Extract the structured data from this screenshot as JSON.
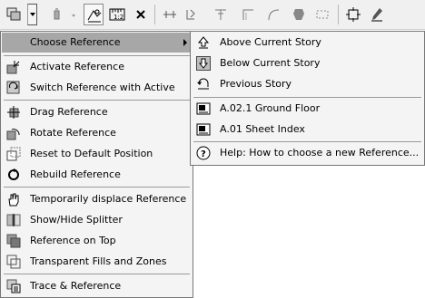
{
  "toolbar": {
    "buttons": [
      {
        "name": "reference-button",
        "icon": "stacked-sheets-icon"
      },
      {
        "name": "trace-on-off",
        "icon": "trace-icon"
      },
      {
        "name": "switch-trace",
        "icon": "switch-icon"
      },
      {
        "name": "compare-reference",
        "icon": "compare-icon"
      },
      {
        "name": "ruler-button",
        "icon": "ruler-icon"
      },
      {
        "name": "close-reference",
        "icon": "close-icon"
      },
      {
        "name": "move-tool",
        "icon": "move-icon"
      },
      {
        "name": "rotate-tool",
        "icon": "rotate-icon"
      },
      {
        "name": "align-tool",
        "icon": "align-icon"
      },
      {
        "name": "offset-tool",
        "icon": "offset-icon"
      },
      {
        "name": "fillet-tool",
        "icon": "fillet-icon"
      },
      {
        "name": "slab-tool",
        "icon": "slab-icon"
      },
      {
        "name": "select-tool",
        "icon": "select-icon"
      },
      {
        "name": "settings-tool",
        "icon": "settings-icon"
      },
      {
        "name": "pencil-tool",
        "icon": "pencil-icon"
      }
    ]
  },
  "menu": {
    "choose_reference": "Choose Reference",
    "activate_reference": "Activate Reference",
    "switch_reference": "Switch Reference with Active",
    "drag_reference": "Drag Reference",
    "rotate_reference": "Rotate Reference",
    "reset_default": "Reset to Default Position",
    "rebuild_reference": "Rebuild Reference",
    "temporarily_displace": "Temporarily displace Reference",
    "show_hide_splitter": "Show/Hide Splitter",
    "reference_on_top": "Reference on Top",
    "transparent_fills": "Transparent Fills and Zones",
    "trace_reference": "Trace & Reference"
  },
  "submenu": {
    "above_story": "Above Current Story",
    "below_story": "Below Current Story",
    "previous_story": "Previous Story",
    "ground_floor": "A.02.1 Ground Floor",
    "sheet_index": "A.01 Sheet Index",
    "help": "Help: How to choose a new Reference..."
  },
  "colors": {
    "highlight": "#a7a7a7",
    "menu_bg": "#f4f4f4",
    "border": "#777777"
  }
}
